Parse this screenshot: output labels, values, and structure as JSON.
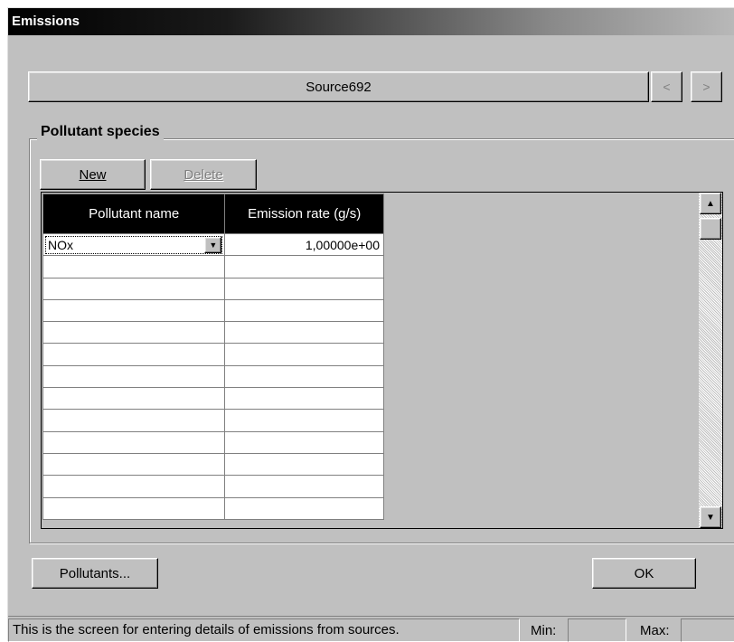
{
  "window": {
    "title": "Emissions"
  },
  "source": {
    "name": "Source692",
    "prev_icon": "chevron-left-icon",
    "next_icon": "chevron-right-icon",
    "prev_label": "<",
    "next_label": ">"
  },
  "group": {
    "title": "Pollutant species",
    "new_label": "New",
    "delete_label": "Delete"
  },
  "grid": {
    "columns": [
      "Pollutant name",
      "Emission rate (g/s)"
    ],
    "rows": [
      {
        "pollutant": "NOx",
        "rate": "1,00000e+00"
      }
    ],
    "empty_rows": 12
  },
  "buttons": {
    "pollutants_label": "Pollutants...",
    "ok_label": "OK"
  },
  "statusbar": {
    "message": "This is the screen for entering details of emissions from sources.",
    "min_label": "Min:",
    "max_label": "Max:",
    "min_value": "",
    "max_value": ""
  }
}
